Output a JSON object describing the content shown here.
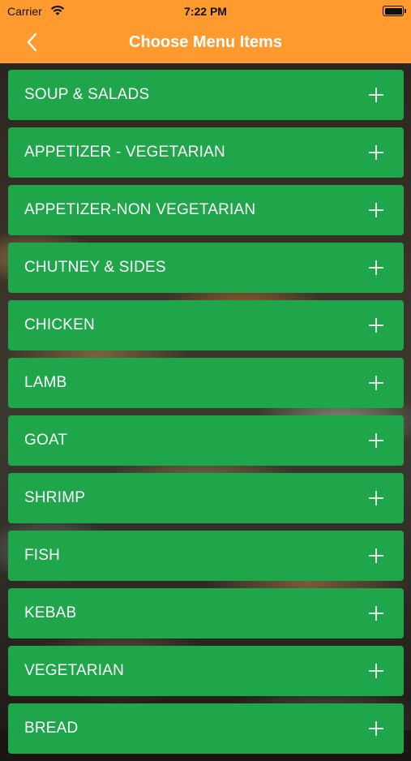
{
  "status_bar": {
    "carrier": "Carrier",
    "time": "7:22 PM",
    "wifi_icon": "wifi-icon",
    "battery_icon": "battery-icon"
  },
  "nav": {
    "title": "Choose Menu Items",
    "back_icon": "chevron-left-icon",
    "background_color": "#ff9a2e"
  },
  "menu": {
    "item_color": "#1fa64a",
    "expand_icon": "plus-icon",
    "items": [
      {
        "label": "SOUP & SALADS"
      },
      {
        "label": "APPETIZER - VEGETARIAN"
      },
      {
        "label": "APPETIZER-NON VEGETARIAN"
      },
      {
        "label": "CHUTNEY & SIDES"
      },
      {
        "label": "CHICKEN"
      },
      {
        "label": "LAMB"
      },
      {
        "label": "GOAT"
      },
      {
        "label": "SHRIMP"
      },
      {
        "label": "FISH"
      },
      {
        "label": "KEBAB"
      },
      {
        "label": "VEGETARIAN"
      },
      {
        "label": "BREAD"
      }
    ]
  }
}
